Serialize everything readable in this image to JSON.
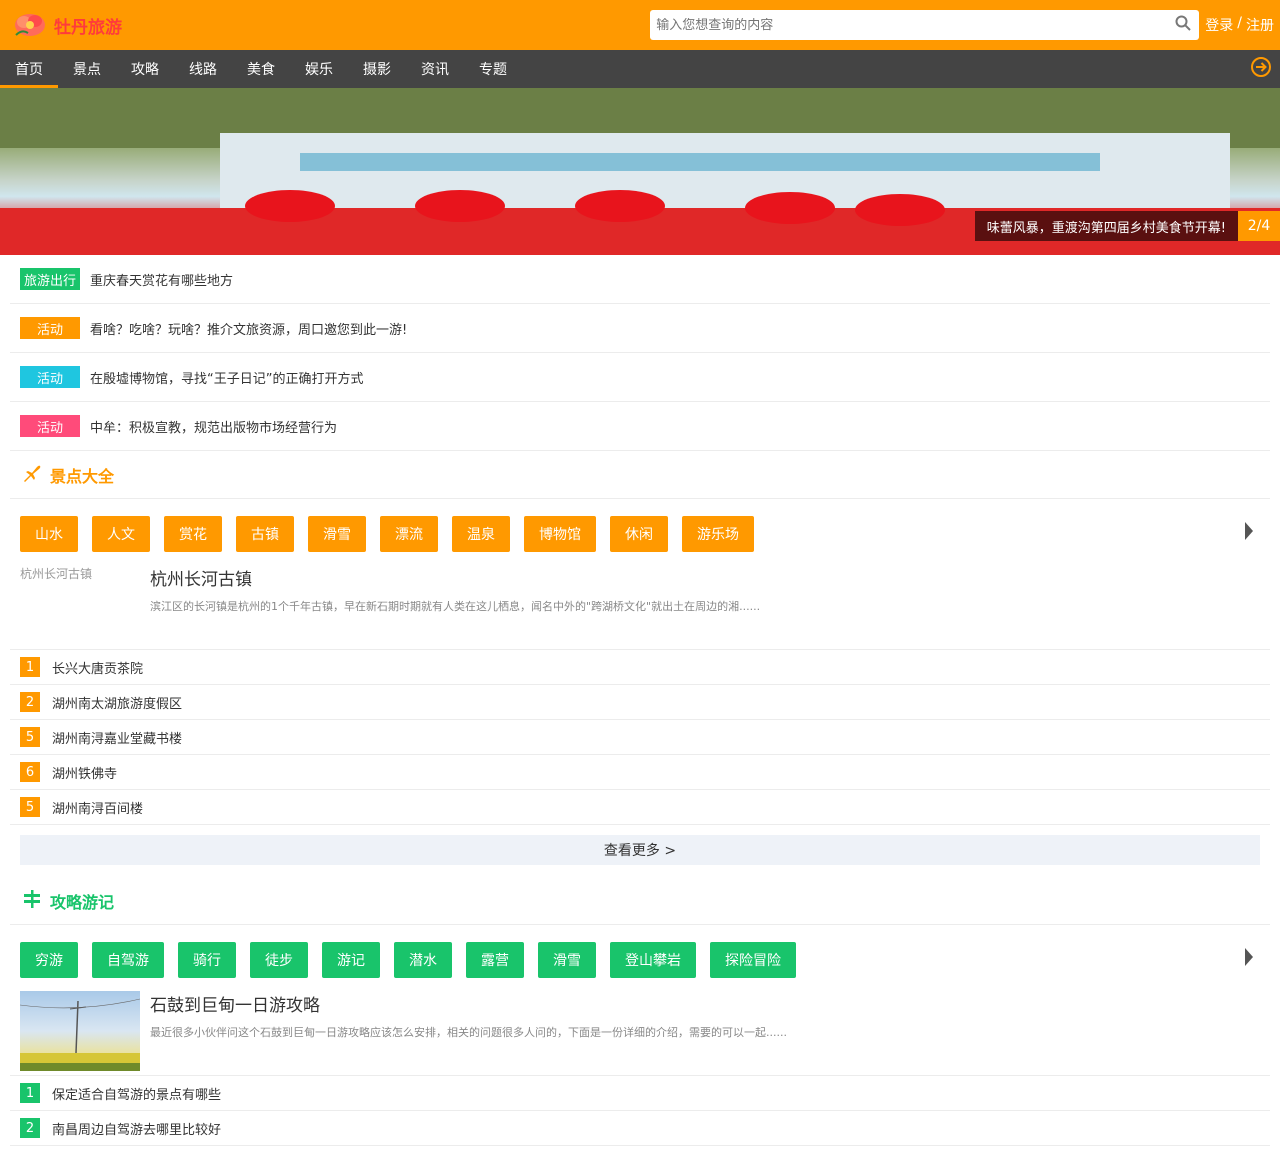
{
  "header": {
    "logo_text": "牡丹旅游",
    "search_placeholder": "输入您想查询的内容",
    "login": "登录",
    "separator": "/",
    "register": "注册"
  },
  "nav": {
    "items": [
      "首页",
      "景点",
      "攻略",
      "线路",
      "美食",
      "娱乐",
      "摄影",
      "资讯",
      "专题"
    ],
    "active_index": 0
  },
  "banner": {
    "caption": "味蕾风暴，重渡沟第四届乡村美食节开幕!",
    "counter": "2/4"
  },
  "news": [
    {
      "tag": "旅游出行",
      "color": "#19c46b",
      "text": "重庆春天赏花有哪些地方"
    },
    {
      "tag": "活动",
      "color": "#ff9900",
      "text": "看啥？吃啥？玩啥？推介文旅资源，周口邀您到此一游!"
    },
    {
      "tag": "活动",
      "color": "#1fc6e0",
      "text": "在殷墟博物馆，寻找“王子日记”的正确打开方式"
    },
    {
      "tag": "活动",
      "color": "#ff4b7a",
      "text": "中牟：积极宣教，规范出版物市场经营行为"
    }
  ],
  "scenic": {
    "title": "景点大全",
    "color": "#ff9900",
    "categories": [
      "山水",
      "人文",
      "赏花",
      "古镇",
      "滑雪",
      "漂流",
      "温泉",
      "博物馆",
      "休闲",
      "游乐场"
    ],
    "feature": {
      "thumb_alt": "杭州长河古镇",
      "title": "杭州长河古镇",
      "desc": "滨江区的长河镇是杭州的1个千年古镇，早在新石期时期就有人类在这儿栖息，闻名中外的\"跨湖桥文化\"就出土在周边的湘......"
    },
    "list": [
      {
        "num": "1",
        "text": "长兴大唐贡茶院"
      },
      {
        "num": "2",
        "text": "湖州南太湖旅游度假区"
      },
      {
        "num": "5",
        "text": "湖州南浔嘉业堂藏书楼"
      },
      {
        "num": "6",
        "text": "湖州铁佛寺"
      },
      {
        "num": "5",
        "text": "湖州南浔百间楼"
      }
    ],
    "more": "查看更多 >"
  },
  "guide": {
    "title": "攻略游记",
    "color": "#19c46b",
    "categories": [
      "穷游",
      "自驾游",
      "骑行",
      "徒步",
      "游记",
      "潜水",
      "露营",
      "滑雪",
      "登山攀岩",
      "探险冒险"
    ],
    "feature": {
      "title": "石鼓到巨甸一日游攻略",
      "desc": "最近很多小伙伴问这个石鼓到巨甸一日游攻略应该怎么安排，相关的问题很多人问的，下面是一份详细的介绍，需要的可以一起......"
    },
    "list": [
      {
        "num": "1",
        "text": "保定适合自驾游的景点有哪些"
      },
      {
        "num": "2",
        "text": "南昌周边自驾游去哪里比较好"
      }
    ]
  }
}
